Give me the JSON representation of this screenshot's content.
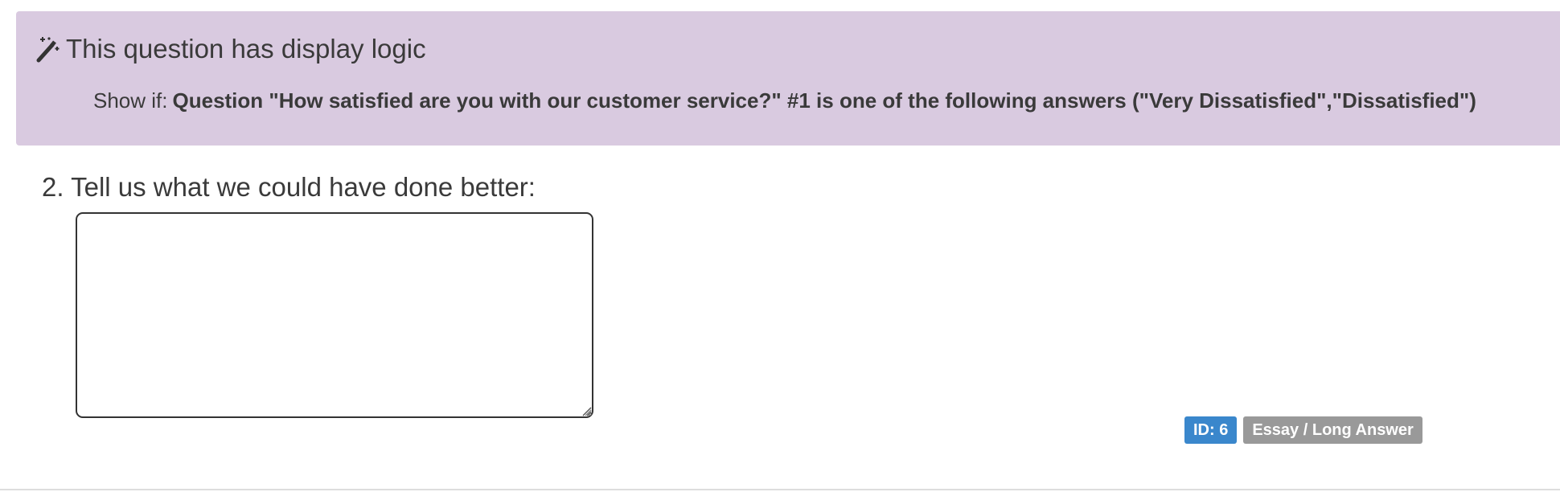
{
  "display_logic": {
    "title": "This question has display logic",
    "icon": "magic-wand-icon",
    "rule_prefix": "Show if:",
    "rule_text": "Question \"How satisfied are you with our customer service?\" #1 is one of the following answers (\"Very Dissatisfied\",\"Dissatisfied\")",
    "background_color": "#d9cae0"
  },
  "question": {
    "label": "2. Tell us what we could have done better:",
    "answer_value": ""
  },
  "badges": {
    "id_label": "ID: 6",
    "type_label": "Essay / Long Answer",
    "id_color": "#3a87cc",
    "type_color": "#999999"
  }
}
